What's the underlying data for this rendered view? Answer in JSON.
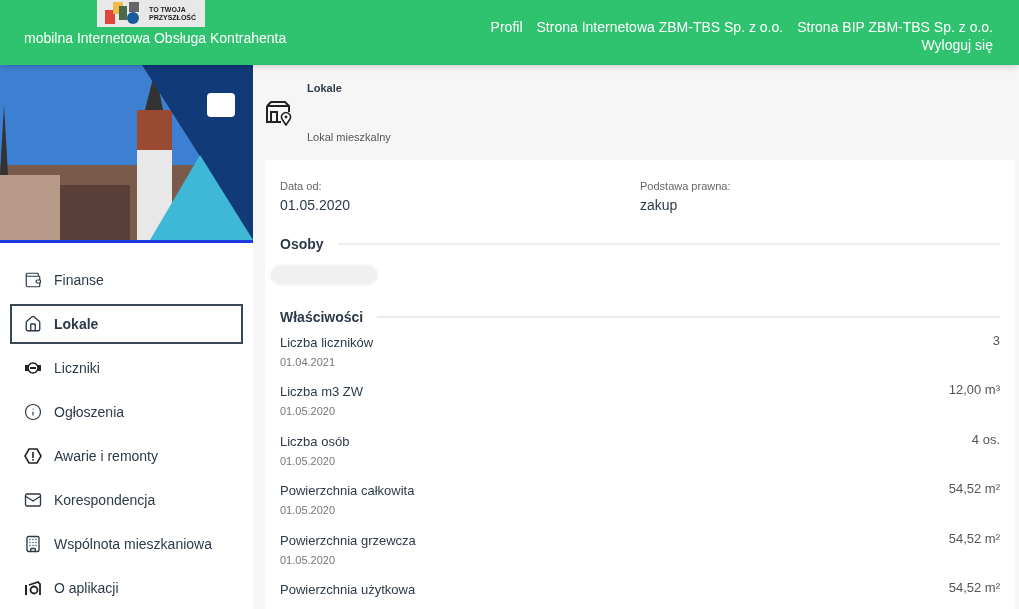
{
  "header": {
    "logo_lines": [
      "TO TWOJA",
      "PRZYSZŁOŚĆ"
    ],
    "app_title": "mobilna Internetowa Obsługa Kontrahenta",
    "links": [
      "Profil",
      "Strona Internetowa ZBM-TBS Sp. z o.o.",
      "Strona BIP ZBM-TBS Sp. z o.o."
    ],
    "logout": "Wyloguj się"
  },
  "sidebar": {
    "items": [
      {
        "label": "Finanse",
        "selected": false
      },
      {
        "label": "Lokale",
        "selected": true
      },
      {
        "label": "Liczniki",
        "selected": false
      },
      {
        "label": "Ogłoszenia",
        "selected": false
      },
      {
        "label": "Awarie i remonty",
        "selected": false
      },
      {
        "label": "Korespondencja",
        "selected": false
      },
      {
        "label": "Wspólnota mieszkaniowa",
        "selected": false
      },
      {
        "label": "O aplikacji",
        "selected": false
      }
    ]
  },
  "page": {
    "title": "Lokale",
    "subtitle": "Lokal mieszkalny"
  },
  "details": {
    "fields": [
      {
        "label": "Data od:",
        "value": "01.05.2020"
      },
      {
        "label": "Podstawa prawna:",
        "value": "zakup"
      }
    ],
    "persons_heading": "Osoby",
    "properties_heading": "Właściwości",
    "properties": [
      {
        "name": "Liczba liczników",
        "date": "01.04.2021",
        "value": "3"
      },
      {
        "name": "Liczba m3 ZW",
        "date": "01.05.2020",
        "value": "12,00 m³"
      },
      {
        "name": "Liczba osób",
        "date": "01.05.2020",
        "value": "4 os."
      },
      {
        "name": "Powierzchnia całkowita",
        "date": "01.05.2020",
        "value": "54,52 m²"
      },
      {
        "name": "Powierzchnia grzewcza",
        "date": "01.05.2020",
        "value": "54,52 m²"
      },
      {
        "name": "Powierzchnia użytkowa",
        "value": "54,52 m²"
      }
    ]
  }
}
